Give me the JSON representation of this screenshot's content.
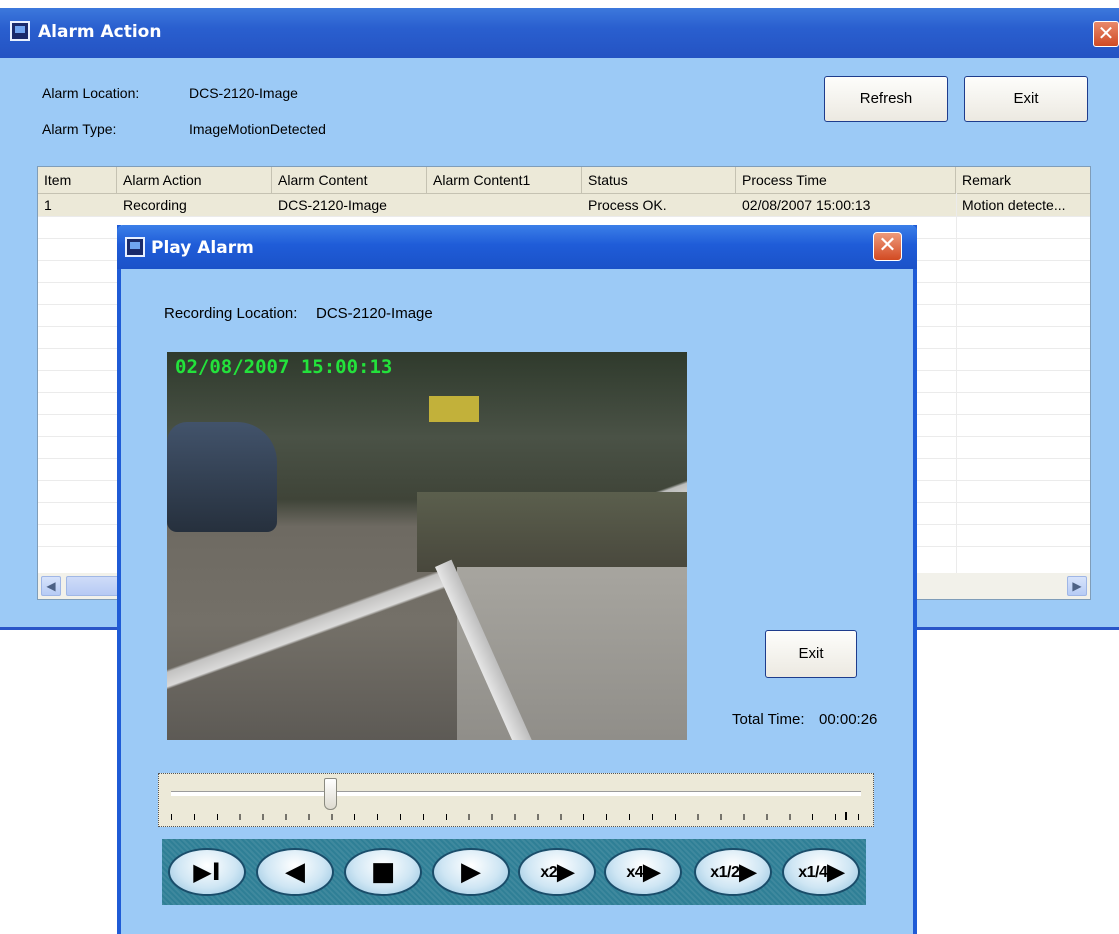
{
  "alarm_window": {
    "title": "Alarm Action",
    "close_glyph": "✕",
    "location_label": "Alarm Location:",
    "location_value": "DCS-2120-Image",
    "type_label": "Alarm Type:",
    "type_value": "ImageMotionDetected",
    "refresh_label": "Refresh",
    "exit_label": "Exit",
    "columns": [
      "Item",
      "Alarm Action",
      "Alarm Content",
      "Alarm Content1",
      "Status",
      "Process Time",
      "Remark"
    ],
    "rows": [
      [
        "1",
        "Recording",
        "DCS-2120-Image",
        "",
        "Process OK.",
        "02/08/2007 15:00:13",
        "Motion detecte..."
      ]
    ],
    "scroll_left_glyph": "◀",
    "scroll_right_glyph": "▶"
  },
  "play_window": {
    "title": "Play Alarm",
    "close_glyph": "✕",
    "recording_location_label": "Recording Location:",
    "recording_location_value": "DCS-2120-Image",
    "video_timestamp": "02/08/2007 15:00:13",
    "exit_label": "Exit",
    "total_time_label": "Total Time:",
    "total_time_value": "00:00:26",
    "playback_position": 0.23,
    "controls": {
      "step": "▶I",
      "reverse": "◀",
      "stop": "■",
      "play": "▶",
      "x2": "x2",
      "x4": "x4",
      "x1_2": "x1/2",
      "x1_4": "x1/4",
      "speed_arrow": "▶"
    }
  },
  "colors": {
    "window_bg": "#9ccaf6",
    "titlebar": "#2453c3",
    "close_button": "#d24a22",
    "timestamp_overlay": "#23e23b",
    "control_strip": "#2f7f96"
  }
}
